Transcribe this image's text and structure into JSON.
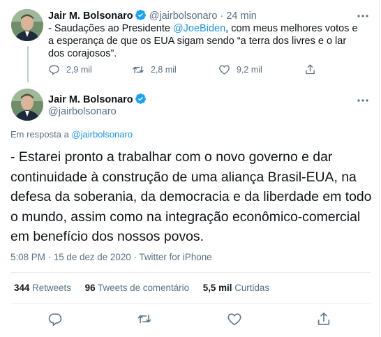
{
  "reply_tweet": {
    "author_name": "Jair M. Bolsonaro",
    "handle": "@jairbolsonaro",
    "separator": "·",
    "time": "24 min",
    "text_before_mention": "- Saudações ao Presidente ",
    "mention": "@JoeBiden",
    "text_after_mention": ", com meus melhores votos e a esperança de que os EUA sigam sendo “a terra dos livres e o lar dos corajosos”.",
    "replies": "2,9 mil",
    "retweets": "2,8 mil",
    "likes": "9,2 mil"
  },
  "main_tweet": {
    "author_name": "Jair M. Bolsonaro",
    "handle": "@jairbolsonaro",
    "reply_prefix": "Em resposta a ",
    "reply_to": "@jairbolsonaro",
    "text": "- Estarei pronto a trabalhar com o novo governo e dar continuidade à construção de uma aliança Brasil-EUA, na defesa da soberania, da democracia e da liberdade em todo o mundo, assim como na integração econômico-comercial em benefício dos nossos povos.",
    "time": "5:08 PM · 15 de dez de 2020",
    "meta_separator": "·",
    "source": "Twitter for iPhone",
    "stats": {
      "retweets_count": "344",
      "retweets_label": "Retweets",
      "comments_count": "96",
      "comments_label": "Tweets de comentário",
      "likes_count": "5,5 mil",
      "likes_label": "Curtidas"
    }
  },
  "colors": {
    "verified": "#1da1f2",
    "link": "#1b95e0",
    "secondary_text": "#5b7083",
    "divider": "#e6ecf0"
  },
  "icons": [
    "verified-badge-icon",
    "more-icon",
    "reply-icon",
    "retweet-icon",
    "like-icon",
    "share-icon"
  ]
}
